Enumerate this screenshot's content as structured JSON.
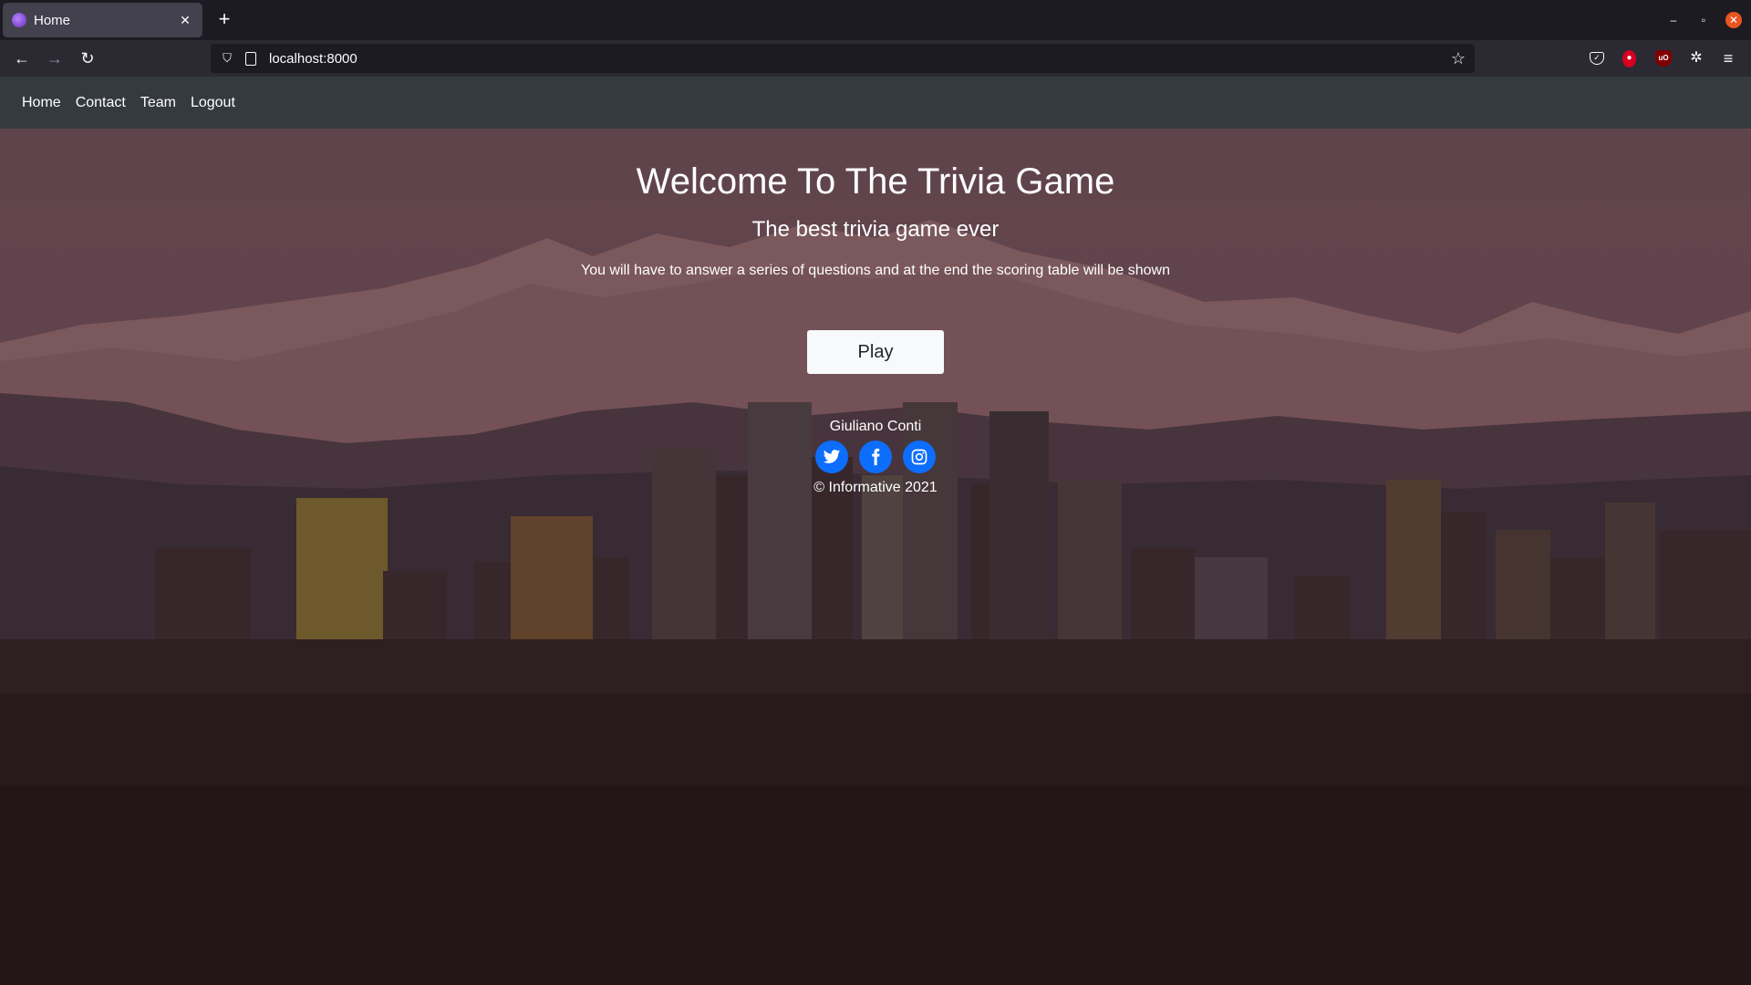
{
  "browser": {
    "tab_title": "Home",
    "tab_close": "✕",
    "new_tab": "+",
    "url": "localhost:8000",
    "window_controls": {
      "minimize": "–",
      "maximize": "▫",
      "close": "✕"
    }
  },
  "site_nav": {
    "items": [
      {
        "label": "Home"
      },
      {
        "label": "Contact"
      },
      {
        "label": "Team"
      },
      {
        "label": "Logout"
      }
    ]
  },
  "hero": {
    "title": "Welcome To The Trivia Game",
    "subtitle": "The best trivia game ever",
    "description": "You will have to answer a series of questions and at the end the scoring table will be shown",
    "play_label": "Play"
  },
  "footer": {
    "author": "Giuliano Conti",
    "socials": [
      {
        "icon": "twitter-icon"
      },
      {
        "icon": "facebook-icon"
      },
      {
        "icon": "instagram-icon"
      }
    ],
    "copyright": "© Informative 2021"
  },
  "colors": {
    "nav_bg": "#343a40",
    "social_accent": "#0d6efd",
    "button_bg": "#f8f9fa"
  }
}
